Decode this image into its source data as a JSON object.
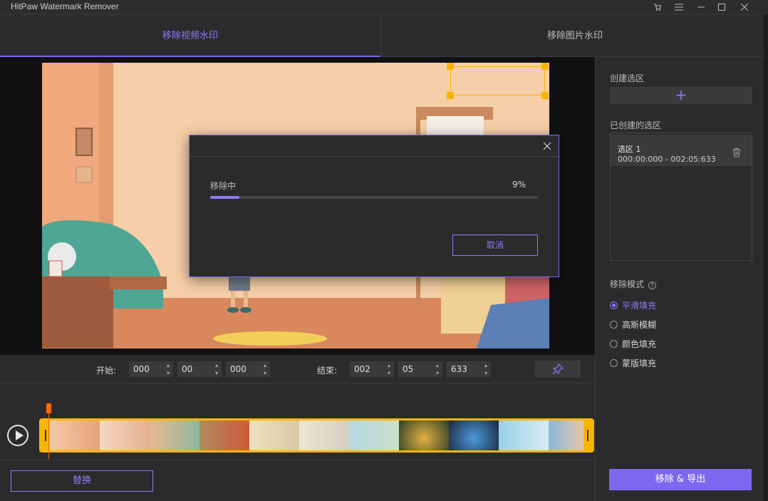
{
  "app": {
    "title": "HitPaw Watermark Remover"
  },
  "window_controls": [
    "cart-icon",
    "menu-icon",
    "minimize-icon",
    "maximize-icon",
    "close-icon"
  ],
  "tabs": [
    {
      "label": "移除视频水印",
      "active": true
    },
    {
      "label": "移除图片水印",
      "active": false
    }
  ],
  "right_panel": {
    "create_region_label": "创建选区",
    "add_symbol": "+",
    "created_regions_label": "已创建的选区",
    "regions": [
      {
        "name": "选区 1",
        "time": "000:00:000 - 002:05:633"
      }
    ],
    "mode_label": "移除模式",
    "help_symbol": "?",
    "modes": [
      {
        "label": "平滑填充",
        "selected": true
      },
      {
        "label": "高斯模糊",
        "selected": false
      },
      {
        "label": "颜色填充",
        "selected": false
      },
      {
        "label": "蒙版填充",
        "selected": false
      }
    ]
  },
  "time_row": {
    "start_label": "开始:",
    "start": [
      "000",
      "00",
      "000"
    ],
    "end_label": "结束:",
    "end": [
      "002",
      "05",
      "633"
    ]
  },
  "buttons": {
    "replace": "替换",
    "export": "移除 & 导出"
  },
  "modal": {
    "progress_label": "移除中",
    "progress_text": "9%",
    "progress_fraction": 0.09,
    "cancel": "取消"
  },
  "colors": {
    "accent": "#7b68ee",
    "selection": "#f7b500",
    "playhead": "#ff6a00"
  }
}
